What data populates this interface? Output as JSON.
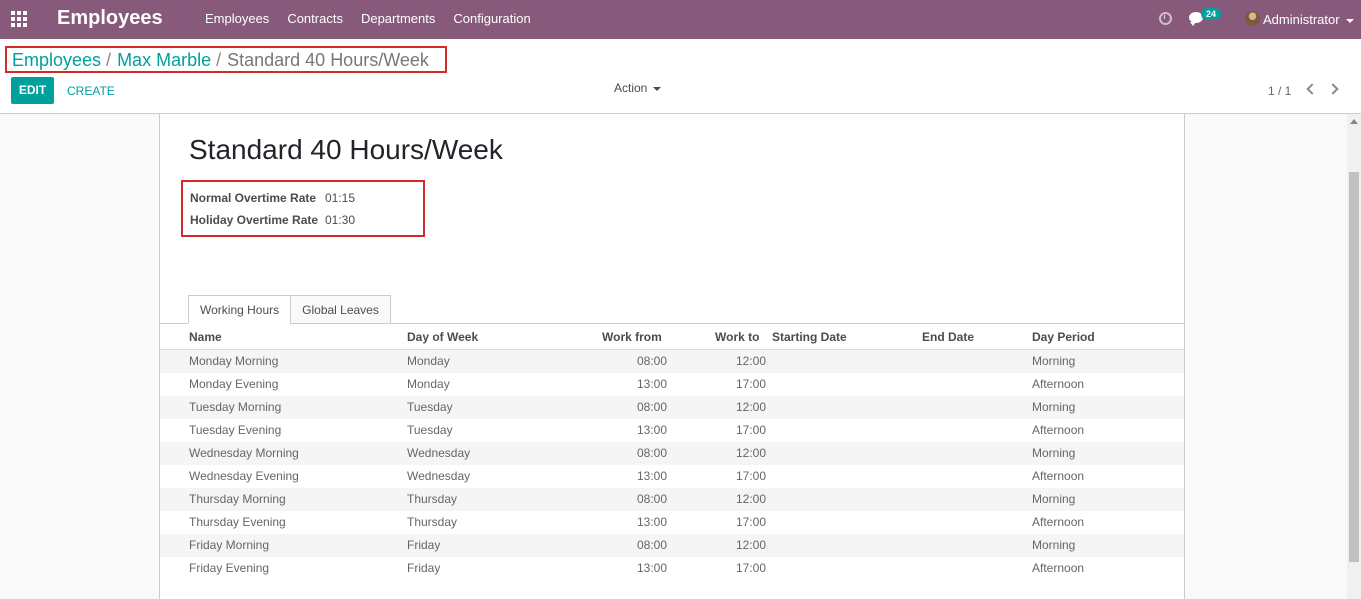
{
  "navbar": {
    "brand": "Employees",
    "menu": [
      "Employees",
      "Contracts",
      "Departments",
      "Configuration"
    ],
    "messages_count": "24",
    "user": "Administrator"
  },
  "breadcrumb": {
    "items": [
      "Employees",
      "Max Marble"
    ],
    "current": "Standard 40 Hours/Week",
    "separator": "/"
  },
  "buttons": {
    "edit": "EDIT",
    "create": "CREATE",
    "action": "Action"
  },
  "pager": {
    "value": "1 / 1"
  },
  "record": {
    "title": "Standard 40 Hours/Week",
    "fields": [
      {
        "label": "Normal Overtime Rate",
        "value": "01:15"
      },
      {
        "label": "Holiday Overtime Rate",
        "value": "01:30"
      }
    ]
  },
  "tabs": [
    "Working Hours",
    "Global Leaves"
  ],
  "table": {
    "columns": [
      "Name",
      "Day of Week",
      "Work from",
      "Work to",
      "Starting Date",
      "End Date",
      "Day Period"
    ],
    "rows": [
      [
        "Monday Morning",
        "Monday",
        "08:00",
        "12:00",
        "",
        "",
        "Morning"
      ],
      [
        "Monday Evening",
        "Monday",
        "13:00",
        "17:00",
        "",
        "",
        "Afternoon"
      ],
      [
        "Tuesday Morning",
        "Tuesday",
        "08:00",
        "12:00",
        "",
        "",
        "Morning"
      ],
      [
        "Tuesday Evening",
        "Tuesday",
        "13:00",
        "17:00",
        "",
        "",
        "Afternoon"
      ],
      [
        "Wednesday Morning",
        "Wednesday",
        "08:00",
        "12:00",
        "",
        "",
        "Morning"
      ],
      [
        "Wednesday Evening",
        "Wednesday",
        "13:00",
        "17:00",
        "",
        "",
        "Afternoon"
      ],
      [
        "Thursday Morning",
        "Thursday",
        "08:00",
        "12:00",
        "",
        "",
        "Morning"
      ],
      [
        "Thursday Evening",
        "Thursday",
        "13:00",
        "17:00",
        "",
        "",
        "Afternoon"
      ],
      [
        "Friday Morning",
        "Friday",
        "08:00",
        "12:00",
        "",
        "",
        "Morning"
      ],
      [
        "Friday Evening",
        "Friday",
        "13:00",
        "17:00",
        "",
        "",
        "Afternoon"
      ]
    ]
  },
  "colors": {
    "navbar": "#875a7b",
    "accent": "#00a09d",
    "highlight_border": "#d32a2a"
  }
}
